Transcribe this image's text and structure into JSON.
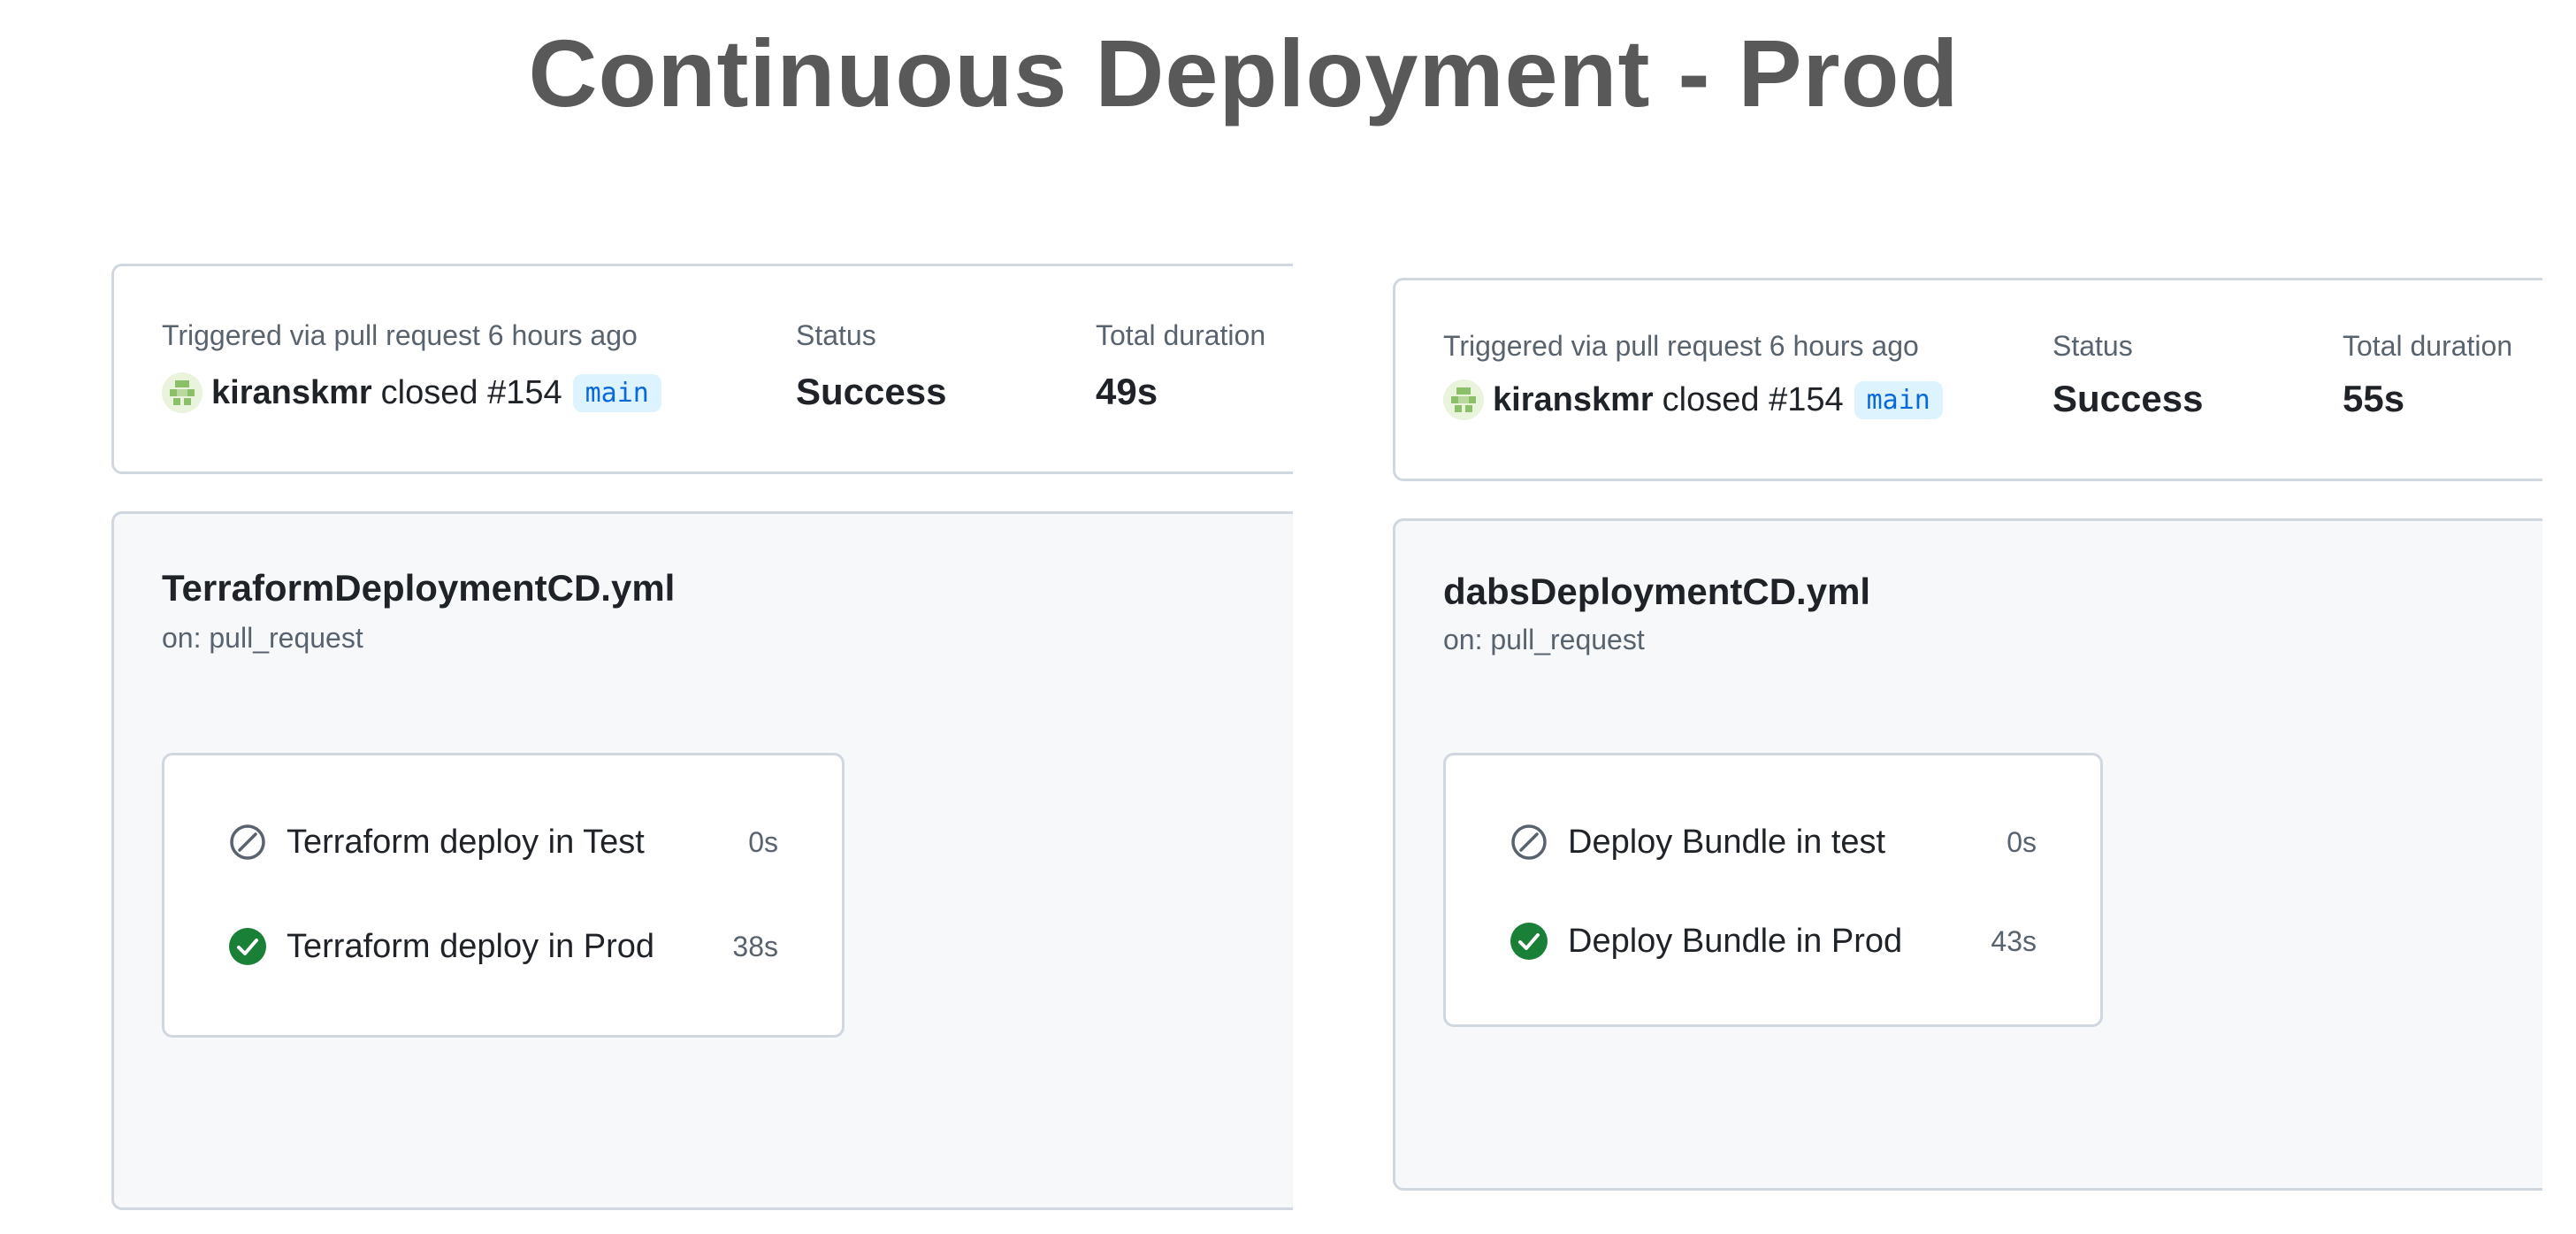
{
  "page_title": "Continuous Deployment - Prod",
  "colors": {
    "success": "#1a7f37",
    "skipped": "#59636e",
    "branch_text": "#0969da",
    "branch_bg": "#ddf4ff",
    "title": "#595959"
  },
  "runs": [
    {
      "trigger_label": "Triggered via pull request 6 hours ago",
      "actor": "kiranskmr",
      "action": "closed #154",
      "branch": "main",
      "status_label": "Status",
      "status": "Success",
      "duration_label": "Total duration",
      "duration": "49s",
      "workflow_file": "TerraformDeploymentCD.yml",
      "workflow_trigger": "on: pull_request",
      "jobs": [
        {
          "name": "Terraform deploy in Test",
          "duration": "0s",
          "state": "skipped",
          "icon": "skipped-icon"
        },
        {
          "name": "Terraform deploy in Prod",
          "duration": "38s",
          "state": "success",
          "icon": "check-circle-icon"
        }
      ]
    },
    {
      "trigger_label": "Triggered via pull request 6 hours ago",
      "actor": "kiranskmr",
      "action": "closed #154",
      "branch": "main",
      "status_label": "Status",
      "status": "Success",
      "duration_label": "Total duration",
      "duration": "55s",
      "workflow_file": "dabsDeploymentCD.yml",
      "workflow_trigger": "on: pull_request",
      "jobs": [
        {
          "name": "Deploy Bundle in test",
          "duration": "0s",
          "state": "skipped",
          "icon": "skipped-icon"
        },
        {
          "name": "Deploy Bundle in Prod",
          "duration": "43s",
          "state": "success",
          "icon": "check-circle-icon"
        }
      ]
    }
  ]
}
